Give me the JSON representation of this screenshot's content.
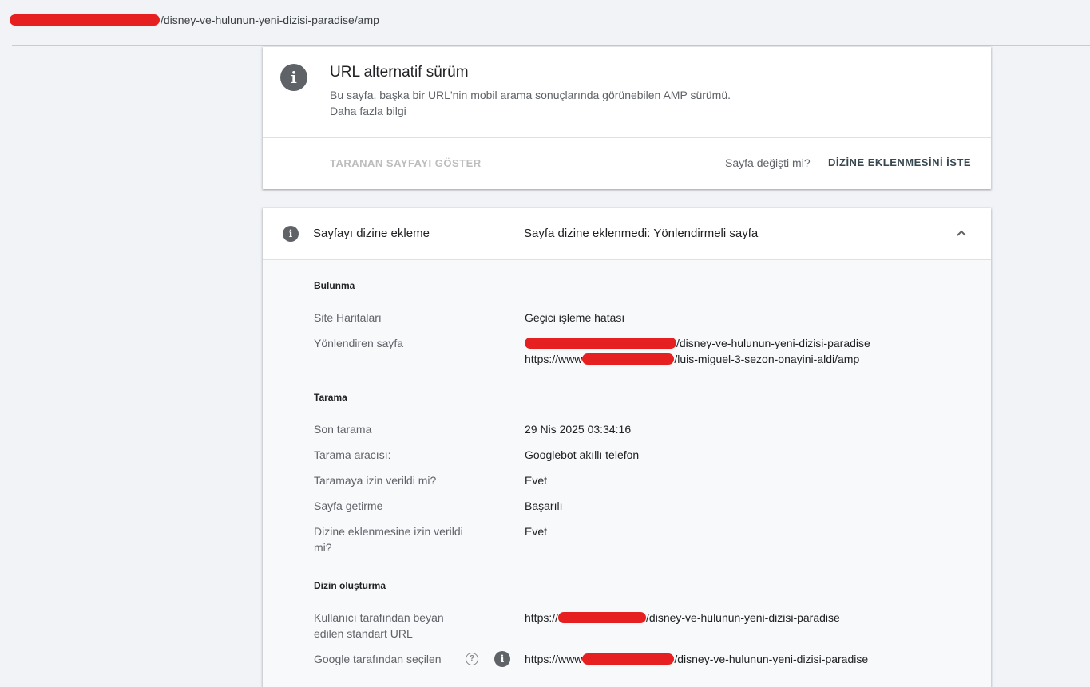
{
  "address_bar": {
    "url_suffix": "/disney-ve-hulunun-yeni-dizisi-paradise/amp"
  },
  "summary_card": {
    "title": "URL alternatif sürüm",
    "description": "Bu sayfa, başka bir URL'nin mobil arama sonuçlarında görünebilen AMP sürümü.",
    "learn_more": "Daha fazla bilgi",
    "view_crawled": "TARANAN SAYFAYI GÖSTER",
    "page_changed": "Sayfa değişti mi?",
    "request_indexing": "DİZİNE EKLENMESİNİ İSTE"
  },
  "indexing_card": {
    "label": "Sayfayı dizine ekleme",
    "status": "Sayfa dizine eklenmedi: Yönlendirmeli sayfa",
    "sections": {
      "discovery": {
        "title": "Bulunma",
        "sitemaps_label": "Site Haritaları",
        "sitemaps_value": "Geçici işleme hatası",
        "referring_label": "Yönlendiren sayfa",
        "referring_1": "/disney-ve-hulunun-yeni-dizisi-paradise",
        "referring_2_prefix": "https://www",
        "referring_2_suffix": "/luis-miguel-3-sezon-onayini-aldi/amp"
      },
      "crawl": {
        "title": "Tarama",
        "last_crawl_label": "Son tarama",
        "last_crawl_value": "29 Nis 2025 03:34:16",
        "crawled_as_label": "Tarama aracısı:",
        "crawled_as_value": "Googlebot akıllı telefon",
        "crawl_allowed_label": "Taramaya izin verildi mi?",
        "crawl_allowed_value": "Evet",
        "page_fetch_label": "Sayfa getirme",
        "page_fetch_value": "Başarılı",
        "indexing_allowed_label": "Dizine eklenmesine izin verildi mi?",
        "indexing_allowed_value": "Evet"
      },
      "indexing": {
        "title": "Dizin oluşturma",
        "user_canonical_label": "Kullanıcı tarafından beyan edilen standart URL",
        "user_canonical_prefix": "https://",
        "user_canonical_suffix": "/disney-ve-hulunun-yeni-dizisi-paradise",
        "google_canonical_label": "Google tarafından seçilen",
        "google_canonical_prefix": "https://www",
        "google_canonical_suffix": "/disney-ve-hulunun-yeni-dizisi-paradise"
      }
    }
  },
  "colors": {
    "background": "#f1f3f7",
    "redaction": "#e62020",
    "icon_gray": "#5f6368"
  },
  "icons": [
    "info-icon",
    "chevron-up-icon",
    "help-icon"
  ]
}
